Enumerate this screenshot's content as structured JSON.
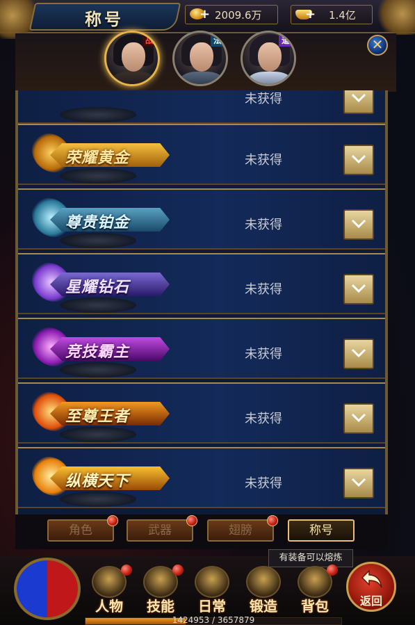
{
  "header": {
    "title": "称号",
    "gold": "2009.6万",
    "ingot": "1.4亿"
  },
  "characters": [
    {
      "tag": "战",
      "active": true
    },
    {
      "tag": "法",
      "active": false
    },
    {
      "tag": "道",
      "active": false
    }
  ],
  "titles": [
    {
      "name": "",
      "status": "未获得",
      "badge_color": "#2a3040",
      "text_color": "#cccccc"
    },
    {
      "name": "荣耀黄金",
      "status": "未获得",
      "badge_color": "#d08a12",
      "text_color": "#ffe9a0"
    },
    {
      "name": "尊贵铂金",
      "status": "未获得",
      "badge_color": "#3a8a9a",
      "text_color": "#e0f4ff"
    },
    {
      "name": "星耀钻石",
      "status": "未获得",
      "badge_color": "#6a4ab0",
      "text_color": "#f0e4ff"
    },
    {
      "name": "竞技霸主",
      "status": "未获得",
      "badge_color": "#9a2ac0",
      "text_color": "#ffd8ff"
    },
    {
      "name": "至尊王者",
      "status": "未获得",
      "badge_color": "#e07a10",
      "text_color": "#fff2b0"
    },
    {
      "name": "纵横天下",
      "status": "未获得",
      "badge_color": "#e89a10",
      "text_color": "#fff6c0"
    }
  ],
  "tabs": [
    {
      "label": "角色",
      "active": false,
      "dot": true
    },
    {
      "label": "武器",
      "active": false,
      "dot": true
    },
    {
      "label": "翅膀",
      "active": false,
      "dot": true
    },
    {
      "label": "称号",
      "active": true,
      "dot": false
    }
  ],
  "tooltip": "有装备可以熔炼",
  "nav": [
    {
      "label": "人物",
      "dot": true
    },
    {
      "label": "技能",
      "dot": true
    },
    {
      "label": "日常",
      "dot": false
    },
    {
      "label": "锻造",
      "dot": false
    },
    {
      "label": "背包",
      "dot": true
    }
  ],
  "back_label": "返回",
  "exp": {
    "text": "1424953 / 3657879",
    "fraction": 0.39
  },
  "icons": {
    "close": "close-icon",
    "expand": "chevron-down-icon",
    "back": "back-arrow-icon"
  }
}
